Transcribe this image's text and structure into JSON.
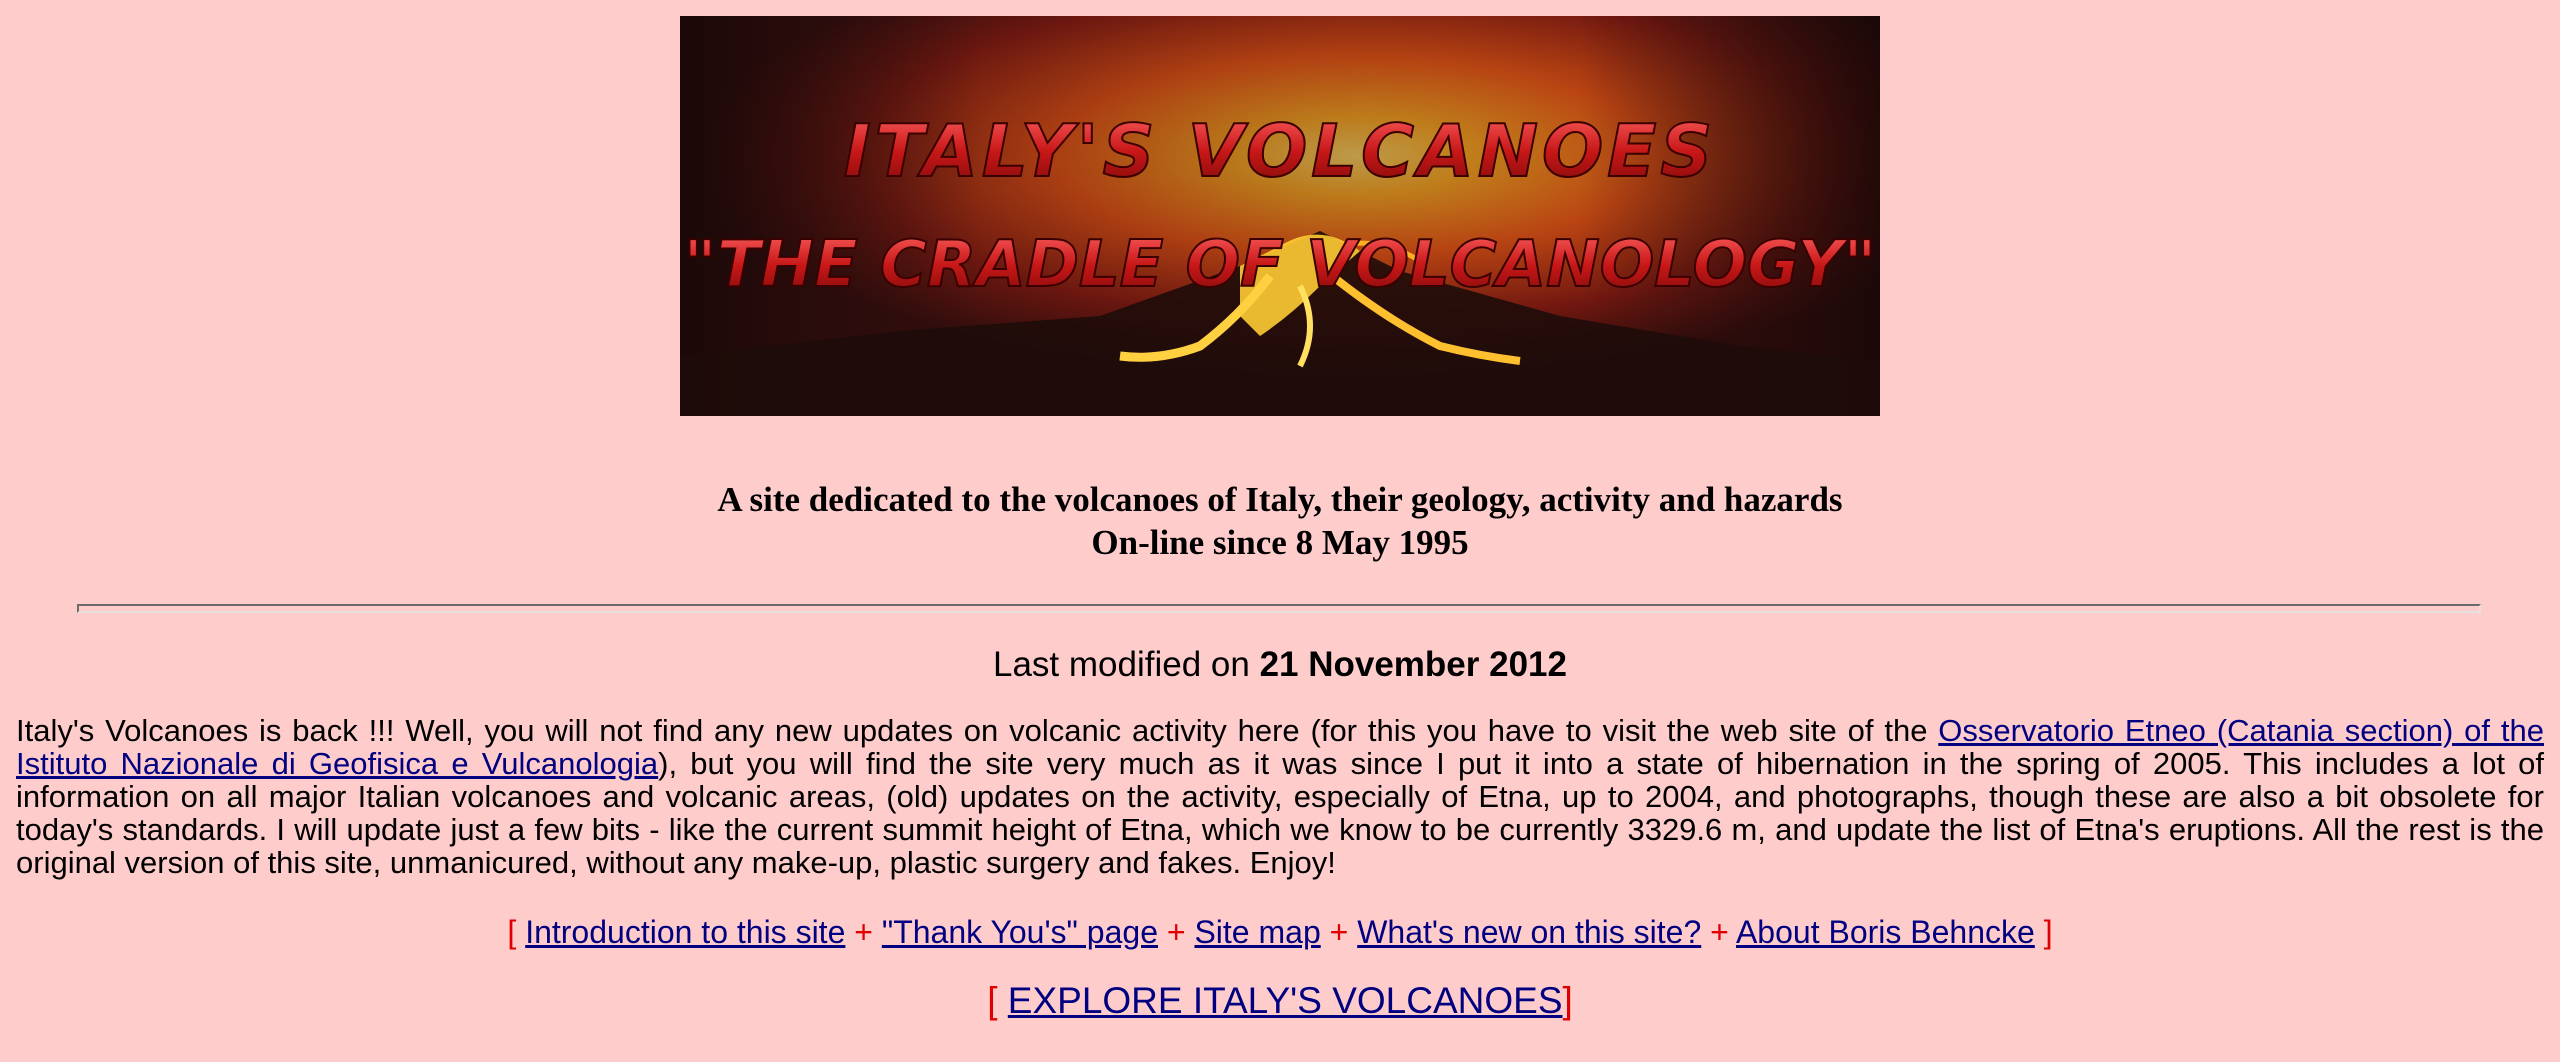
{
  "banner": {
    "title_line1": "ITALY'S  VOLCANOES",
    "title_line2": "\"THE CRADLE OF VOLCANOLOGY\""
  },
  "tagline": {
    "line1": "A site dedicated to the volcanoes of Italy, their geology, activity and hazards",
    "line2": "On-line since 8 May 1995"
  },
  "last_modified": {
    "prefix": "Last modified on ",
    "date": "21 November 2012"
  },
  "intro": {
    "text_before_link": "Italy's Volcanoes is back !!! Well, you will not find any new updates on volcanic activity here (for this you have to visit the web site of the ",
    "link_text": "Osservatorio Etneo (Catania section) of the Istituto Nazionale di Geofisica e Vulcanologia",
    "text_after_link": "), but you will find the site very much as it was since I put it into a state of hibernation in the spring of 2005. This includes a lot of information on all major Italian volcanoes and volcanic areas, (old) updates on the activity, especially of Etna, up to 2004, and photographs, though these are also a bit obsolete for today's standards. I will update just a few bits - like the current summit height of Etna, which we know to be currently 3329.6 m, and update the list of Etna's eruptions. All the rest is the original version of this site, unmanicured, without any make-up, plastic surgery and fakes. Enjoy!"
  },
  "nav": {
    "open_bracket": "[ ",
    "close_bracket": " ]",
    "separator": " + ",
    "links": [
      "Introduction to this site",
      "\"Thank You's\" page",
      "Site map",
      "What's new on this site?",
      "About Boris Behncke"
    ]
  },
  "explore": {
    "open_bracket": "[ ",
    "link": "EXPLORE ITALY'S VOLCANOES",
    "close_bracket": "]"
  },
  "colors": {
    "background": "#ffcccc",
    "link": "#000080",
    "bracket": "#e00000"
  }
}
